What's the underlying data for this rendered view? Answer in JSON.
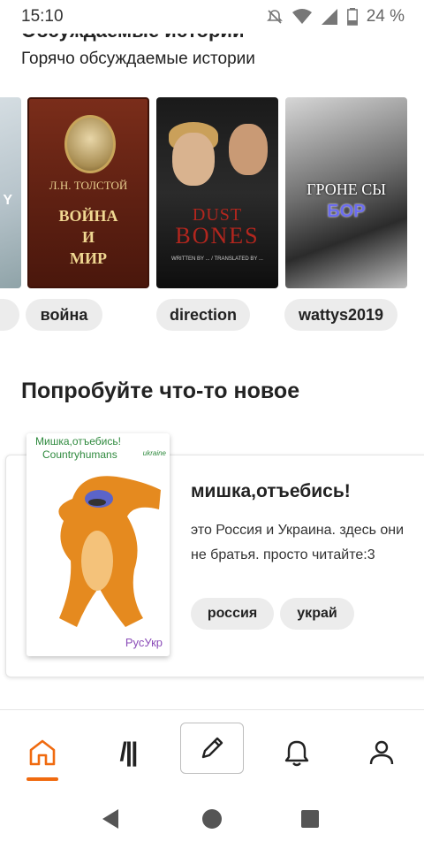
{
  "status_bar": {
    "time": "15:10",
    "battery": "24 %",
    "icons": [
      "mute-icon",
      "wifi-icon",
      "signal-icon",
      "battery-icon"
    ]
  },
  "section_trending": {
    "cut_title": "Обсуждаемые истории",
    "subtitle": "Горячо обсуждаемые истории",
    "books": [
      {
        "cover_text": "Y"
      },
      {
        "cover_author": "Л.Н. ТОЛСТОЙ",
        "cover_title_line1": "ВОЙНА",
        "cover_title_line2": "И",
        "cover_title_line3": "МИР"
      },
      {
        "cover_title_line1": "DUST",
        "cover_title_line2": "BONES",
        "cover_small": "WRITTEN BY ... / TRANSLATED BY ..."
      },
      {
        "cover_title_line1": "ГРОНЕ СЫ",
        "cover_title_line2": "БОР"
      }
    ],
    "tags": [
      "",
      "война",
      "direction",
      "wattys2019"
    ]
  },
  "section_new": {
    "title": "Попробуйте что-то новое",
    "story": {
      "title": "мишка,отъебись!",
      "description": "это Россия и Украина. здесь они не братья. просто читайте:3",
      "cover_line1": "Мишка,отъебись!",
      "cover_line2": "Countryhumans",
      "cover_side": "ukraine",
      "cover_footer": "РусУкр",
      "tags": [
        "россия",
        "украй"
      ]
    }
  },
  "bottom_nav": {
    "items": [
      "home-icon",
      "library-icon",
      "write-icon",
      "bell-icon",
      "profile-icon"
    ],
    "active": "home",
    "library_glyph": "/||",
    "accent_color": "#f06a0f"
  },
  "system_nav": {
    "items": [
      "back-icon",
      "home-circle-icon",
      "recents-icon"
    ]
  }
}
